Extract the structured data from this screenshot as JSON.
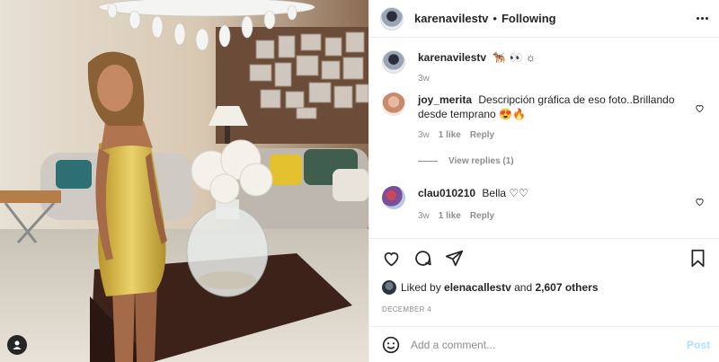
{
  "header": {
    "username": "karenavilestv",
    "separator": "•",
    "follow_status": "Following",
    "more_icon": "more-horizontal-icon"
  },
  "caption": {
    "username": "karenavilestv",
    "text": "🐕‍🦺 👀 ☼",
    "time": "3w"
  },
  "comments": [
    {
      "username": "joy_merita",
      "text": "Descripción gráfica de eso foto..Brillando desde temprano 😍🔥",
      "time": "3w",
      "likes": "1 like",
      "reply_label": "Reply",
      "view_replies": "View replies (1)"
    },
    {
      "username": "clau010210",
      "text": "Bella ♡♡",
      "time": "3w",
      "likes": "1 like",
      "reply_label": "Reply"
    }
  ],
  "actions": {
    "icons": [
      "heart-icon",
      "comment-icon",
      "share-icon",
      "bookmark-icon"
    ]
  },
  "likes": {
    "prefix": "Liked by",
    "user": "elenacallestv",
    "middle": "and",
    "others": "2,607 others"
  },
  "date": "DECEMBER 4",
  "add_comment": {
    "placeholder": "Add a comment...",
    "post_label": "Post",
    "emoji_icon": "emoji-icon"
  },
  "colors": {
    "border": "#efefef",
    "muted": "#8e8e8e",
    "post_button": "#b2dffc",
    "dress": "#d8b737"
  }
}
